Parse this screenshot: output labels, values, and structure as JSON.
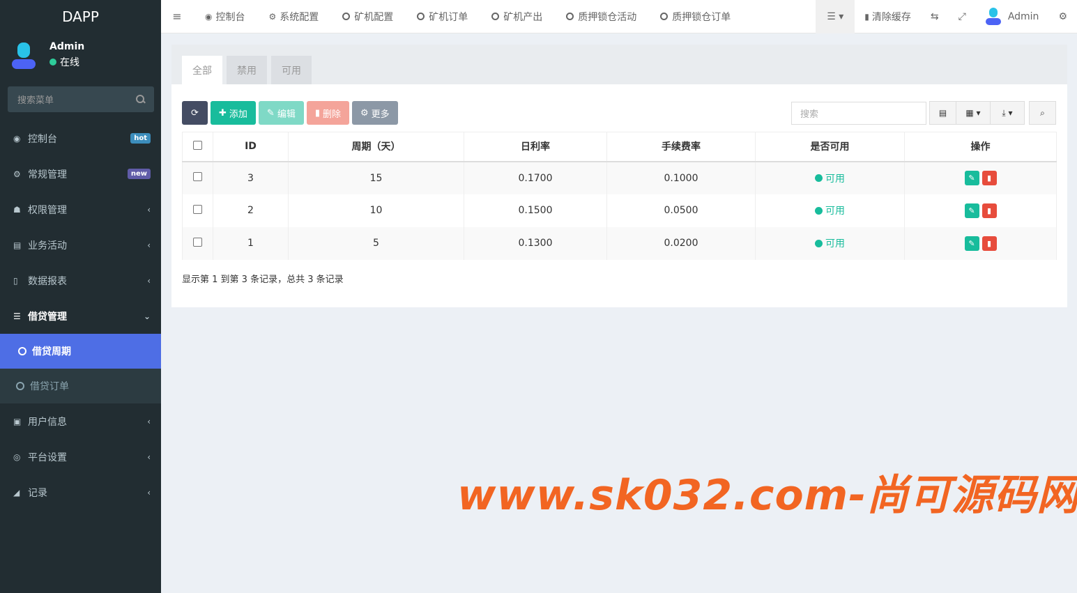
{
  "app": {
    "title": "DAPP"
  },
  "user": {
    "name": "Admin",
    "status": "在线"
  },
  "sidebar": {
    "search_placeholder": "搜索菜单",
    "items": [
      {
        "label": "控制台",
        "icon": "dashboard-icon",
        "badge": "hot"
      },
      {
        "label": "常规管理",
        "icon": "cogs-icon",
        "badge": "new"
      },
      {
        "label": "权限管理",
        "icon": "users-icon"
      },
      {
        "label": "业务活动",
        "icon": "newspaper-icon"
      },
      {
        "label": "数据报表",
        "icon": "file-icon"
      },
      {
        "label": "借贷管理",
        "icon": "list-icon"
      },
      {
        "label": "用户信息",
        "icon": "address-book-icon"
      },
      {
        "label": "平台设置",
        "icon": "circle-dot-icon"
      },
      {
        "label": "记录",
        "icon": "area-chart-icon"
      }
    ],
    "submenu": [
      {
        "label": "借贷周期",
        "active": true
      },
      {
        "label": "借贷订单",
        "active": false
      }
    ]
  },
  "topnav": {
    "tabs": [
      "控制台",
      "系统配置",
      "矿机配置",
      "矿机订单",
      "矿机产出",
      "质押锁仓活动",
      "质押锁仓订单"
    ],
    "clear_cache": "清除缓存",
    "admin": "Admin"
  },
  "content": {
    "tabs": [
      "全部",
      "禁用",
      "可用"
    ],
    "toolbar": {
      "add": "添加",
      "edit": "编辑",
      "delete": "删除",
      "more": "更多"
    },
    "search_placeholder": "搜索",
    "table": {
      "headers": [
        "ID",
        "周期（天）",
        "日利率",
        "手续费率",
        "是否可用",
        "操作"
      ],
      "rows": [
        {
          "id": "3",
          "period": "15",
          "rate": "0.1700",
          "fee": "0.1000",
          "status": "可用"
        },
        {
          "id": "2",
          "period": "10",
          "rate": "0.1500",
          "fee": "0.0500",
          "status": "可用"
        },
        {
          "id": "1",
          "period": "5",
          "rate": "0.1300",
          "fee": "0.0200",
          "status": "可用"
        }
      ]
    },
    "pagination_info": "显示第 1 到第 3 条记录，总共 3 条记录"
  },
  "watermark": "www.sk032.com-尚可源码网",
  "colors": {
    "sidebar_bg": "#222d32",
    "active": "#4e6ee5",
    "success": "#18bc9c",
    "danger": "#e74c3c",
    "watermark": "#f26522"
  }
}
